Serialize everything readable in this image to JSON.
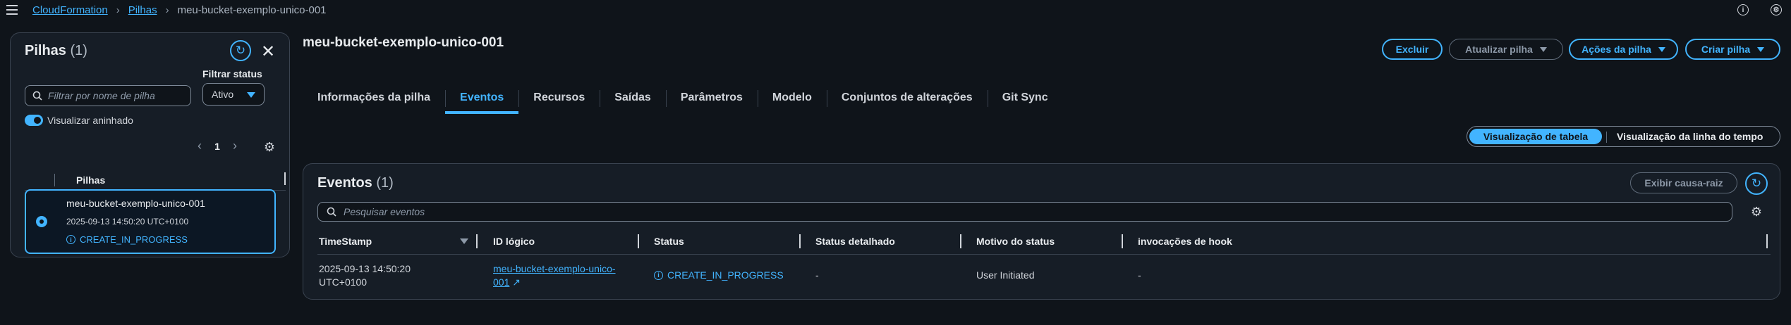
{
  "breadcrumb": {
    "root": "CloudFormation",
    "parent": "Pilhas",
    "current": "meu-bucket-exemplo-unico-001"
  },
  "left_panel": {
    "title": "Pilhas",
    "count": "(1)",
    "search_placeholder": "Filtrar por nome de pilha",
    "filter_label": "Filtrar status",
    "filter_value": "Ativo",
    "toggle_label": "Visualizar aninhado",
    "page": "1",
    "column_header": "Pilhas",
    "stack": {
      "name": "meu-bucket-exemplo-unico-001",
      "time": "2025-09-13 14:50:20 UTC+0100",
      "status": "CREATE_IN_PROGRESS"
    }
  },
  "main": {
    "title": "meu-bucket-exemplo-unico-001",
    "buttons": {
      "delete": "Excluir",
      "update": "Atualizar pilha",
      "actions": "Ações da pilha",
      "create": "Criar pilha"
    },
    "tabs": [
      "Informações da pilha",
      "Eventos",
      "Recursos",
      "Saídas",
      "Parâmetros",
      "Modelo",
      "Conjuntos de alterações",
      "Git Sync"
    ],
    "view_toggle": {
      "table": "Visualização de tabela",
      "timeline": "Visualização da linha do tempo"
    }
  },
  "events": {
    "title": "Eventos",
    "count": "(1)",
    "root_cause_button": "Exibir causa-raiz",
    "search_placeholder": "Pesquisar eventos",
    "columns": [
      "TimeStamp",
      "ID lógico",
      "Status",
      "Status detalhado",
      "Motivo do status",
      "invocações de hook"
    ],
    "rows": [
      {
        "timestamp_line1": "2025-09-13 14:50:20",
        "timestamp_line2": "UTC+0100",
        "logical_id_line1": "meu-bucket-exemplo-unico-",
        "logical_id_line2": "001",
        "status": "CREATE_IN_PROGRESS",
        "detailed_status": "-",
        "reason": "User Initiated",
        "hooks": "-"
      }
    ]
  },
  "colors": {
    "accent": "#42b4ff",
    "background": "#0f141a",
    "panel": "#161d26"
  }
}
